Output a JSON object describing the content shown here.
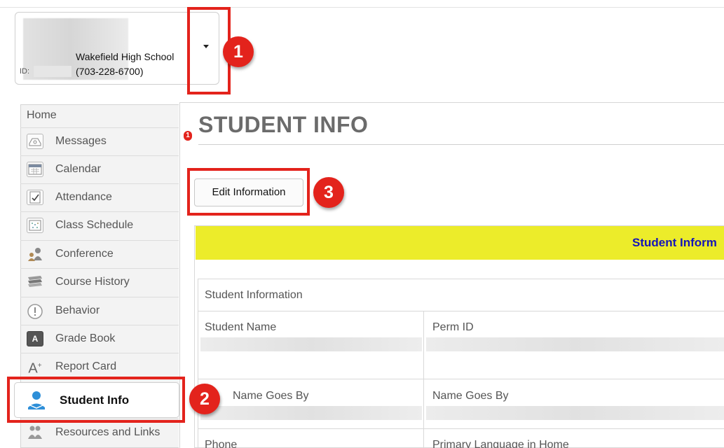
{
  "student_card": {
    "school_name": "Wakefield High School",
    "phone": "(703-228-6700)",
    "id_label": "ID:"
  },
  "annotations": [
    "1",
    "2",
    "3"
  ],
  "sidebar": {
    "home_label": "Home",
    "items": [
      {
        "label": "Messages",
        "icon": "messages-icon",
        "badge": "1"
      },
      {
        "label": "Calendar",
        "icon": "calendar-icon"
      },
      {
        "label": "Attendance",
        "icon": "attendance-icon"
      },
      {
        "label": "Class Schedule",
        "icon": "schedule-icon"
      },
      {
        "label": "Conference",
        "icon": "conference-icon"
      },
      {
        "label": "Course History",
        "icon": "books-icon"
      },
      {
        "label": "Behavior",
        "icon": "behavior-icon"
      },
      {
        "label": "Grade Book",
        "icon": "gradebook-icon"
      },
      {
        "label": "Report Card",
        "icon": "report-card-icon"
      },
      {
        "label": "Student Info",
        "icon": "student-info-icon",
        "active": true
      },
      {
        "label": "Resources and Links",
        "icon": "resources-icon"
      }
    ]
  },
  "main": {
    "title": "STUDENT INFO",
    "edit_button": "Edit Information",
    "banner": "Student Inform",
    "section_title": "Student Information",
    "fields": {
      "student_name": "Student Name",
      "perm_id": "Perm ID",
      "name_goes_by_left": "Name Goes By",
      "name_goes_by_right": "Name Goes By",
      "phone": "Phone",
      "primary_language": "Primary Language in Home"
    }
  },
  "colors": {
    "annotation_red": "#e3231c",
    "banner_yellow": "#ecec2a",
    "banner_text": "#1515b8"
  }
}
